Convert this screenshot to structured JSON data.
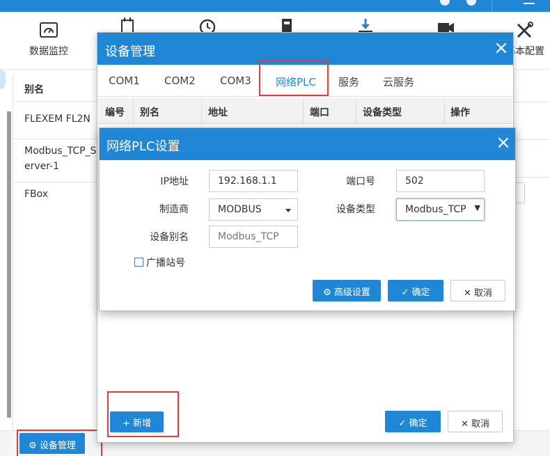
{
  "toolbar": {
    "items": [
      {
        "label": "数据监控",
        "icon": "monitor-gauge-icon"
      },
      {
        "label": "",
        "icon": "plc-device-icon"
      },
      {
        "label": "",
        "icon": "history-clock-icon"
      },
      {
        "label": "",
        "icon": "device-box-icon"
      },
      {
        "label": "",
        "icon": "download-icon"
      },
      {
        "label": "",
        "icon": "camera-icon"
      },
      {
        "label": "基本配置",
        "icon": "tools-icon"
      }
    ]
  },
  "background_list": {
    "header": "别名",
    "rows": [
      "FLEXEM FL2N",
      "Modbus_TCP_Server-1",
      "FBox"
    ],
    "row_display": [
      "FLEXEM FL2N",
      "Modbus_TCP_S\nerver-1",
      "FBox"
    ]
  },
  "bottombar": {
    "device_mgmt_label": "设备管理"
  },
  "device_dialog": {
    "title": "设备管理",
    "tabs": [
      "COM1",
      "COM2",
      "COM3",
      "网络PLC",
      "服务",
      "云服务"
    ],
    "active_tab": "网络PLC",
    "columns": [
      "编号",
      "别名",
      "地址",
      "端口",
      "设备类型",
      "操作"
    ],
    "add_label": "新增",
    "ok_label": "确定",
    "cancel_label": "取消"
  },
  "plc_dialog": {
    "title": "网络PLC设置",
    "ip_label": "IP地址",
    "ip_value": "192.168.1.1",
    "port_label": "端口号",
    "port_value": "502",
    "vendor_label": "制造商",
    "vendor_value": "MODBUS",
    "type_label": "设备类型",
    "type_value": "Modbus_TCP",
    "alias_label": "设备别名",
    "alias_placeholder": "Modbus_TCP",
    "broadcast_label": "广播站号",
    "broadcast_checked": false,
    "advanced_label": "高级设置",
    "ok_label": "确定",
    "cancel_label": "取消"
  },
  "colors": {
    "accent": "#1f87d6",
    "highlight": "#e03a3a"
  }
}
